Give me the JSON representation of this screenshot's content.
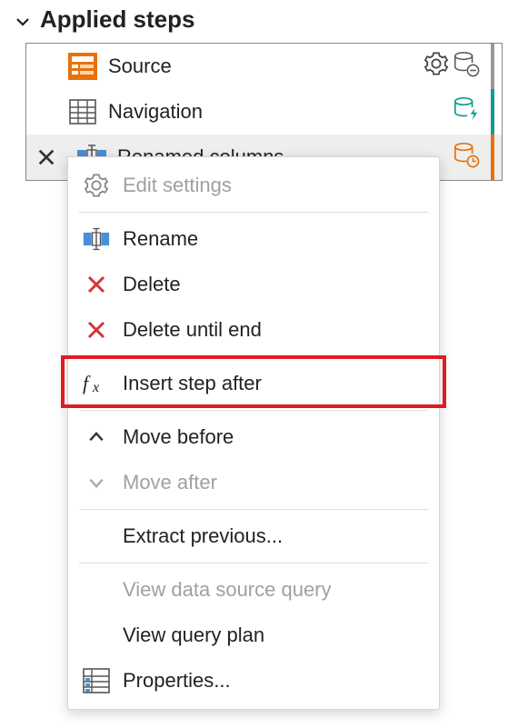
{
  "header": {
    "title": "Applied steps"
  },
  "steps": [
    {
      "name": "Source"
    },
    {
      "name": "Navigation"
    },
    {
      "name": "Renamed columns"
    }
  ],
  "menu": {
    "edit_settings": "Edit settings",
    "rename": "Rename",
    "delete": "Delete",
    "delete_until_end": "Delete until end",
    "insert_step_after": "Insert step after",
    "move_before": "Move before",
    "move_after": "Move after",
    "extract_previous": "Extract previous...",
    "view_data_source_query": "View data source query",
    "view_query_plan": "View query plan",
    "properties": "Properties..."
  }
}
